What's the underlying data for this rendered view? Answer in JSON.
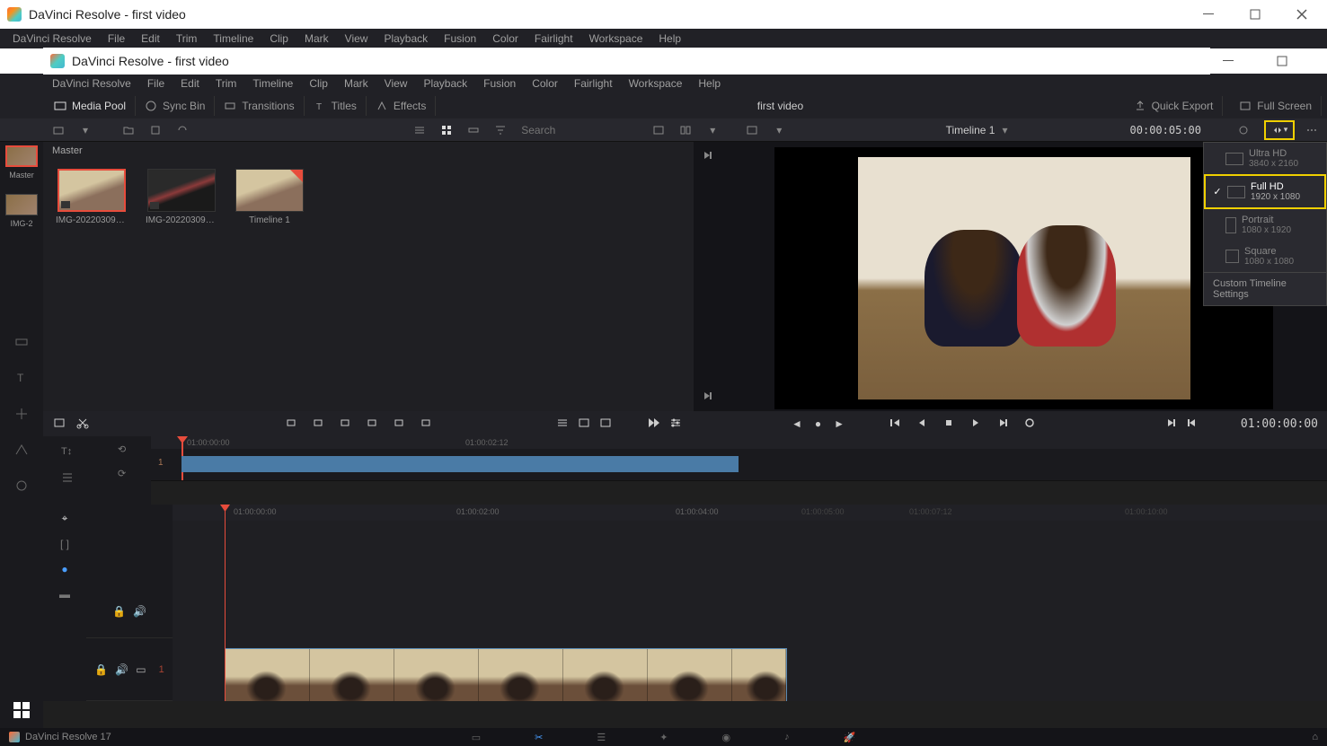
{
  "outer_window": {
    "title": "DaVinci Resolve - first video"
  },
  "outer_menu": [
    "DaVinci Resolve",
    "File",
    "Edit",
    "Trim",
    "Timeline",
    "Clip",
    "Mark",
    "View",
    "Playback",
    "Fusion",
    "Color",
    "Fairlight",
    "Workspace",
    "Help"
  ],
  "inner_window": {
    "title": "DaVinci Resolve - first video"
  },
  "inner_menu": [
    "DaVinci Resolve",
    "File",
    "Edit",
    "Trim",
    "Timeline",
    "Clip",
    "Mark",
    "View",
    "Playback",
    "Fusion",
    "Color",
    "Fairlight",
    "Workspace",
    "Help"
  ],
  "toolrow": {
    "media_pool": "Media Pool",
    "sync_bin": "Sync Bin",
    "transitions": "Transitions",
    "titles": "Titles",
    "effects": "Effects",
    "center": "first video",
    "quick_export": "Quick Export",
    "full_screen": "Full Screen"
  },
  "iconstrip": {
    "search_placeholder": "Search"
  },
  "left_sidebar": {
    "master": "Master",
    "thumb_label": "IMG-2"
  },
  "media_pool": {
    "header": "Master",
    "items": [
      {
        "name": "IMG-20220309-W...",
        "selected": true
      },
      {
        "name": "IMG-20220309-W...",
        "selected": false,
        "dark": true
      },
      {
        "name": "Timeline 1",
        "selected": false,
        "timeline": true
      }
    ]
  },
  "viewer": {
    "timeline_label": "Timeline 1",
    "timecode_top": "00:00:05:00",
    "timecode_right": "01:00:00:00"
  },
  "resolution_menu": {
    "items": [
      {
        "name": "Ultra HD",
        "dims": "3840 x 2160",
        "selected": false
      },
      {
        "name": "Full HD",
        "dims": "1920 x 1080",
        "selected": true
      },
      {
        "name": "Portrait",
        "dims": "1080 x 1920",
        "selected": false
      },
      {
        "name": "Square",
        "dims": "1080 x 1080",
        "selected": false
      }
    ],
    "footer": "Custom Timeline Settings"
  },
  "mini_timeline": {
    "ticks": [
      "01:00:00:00",
      "01:00:02:12"
    ],
    "track_num": "1"
  },
  "big_timeline": {
    "ticks": [
      "01:00:00:00",
      "01:00:02:00",
      "01:00:04:00"
    ],
    "faded_ticks": [
      "01:00:05:00",
      "01:00:07:12",
      "01:00:10:00"
    ],
    "track_num": "1"
  },
  "bottombar": {
    "app": "DaVinci Resolve 17"
  }
}
